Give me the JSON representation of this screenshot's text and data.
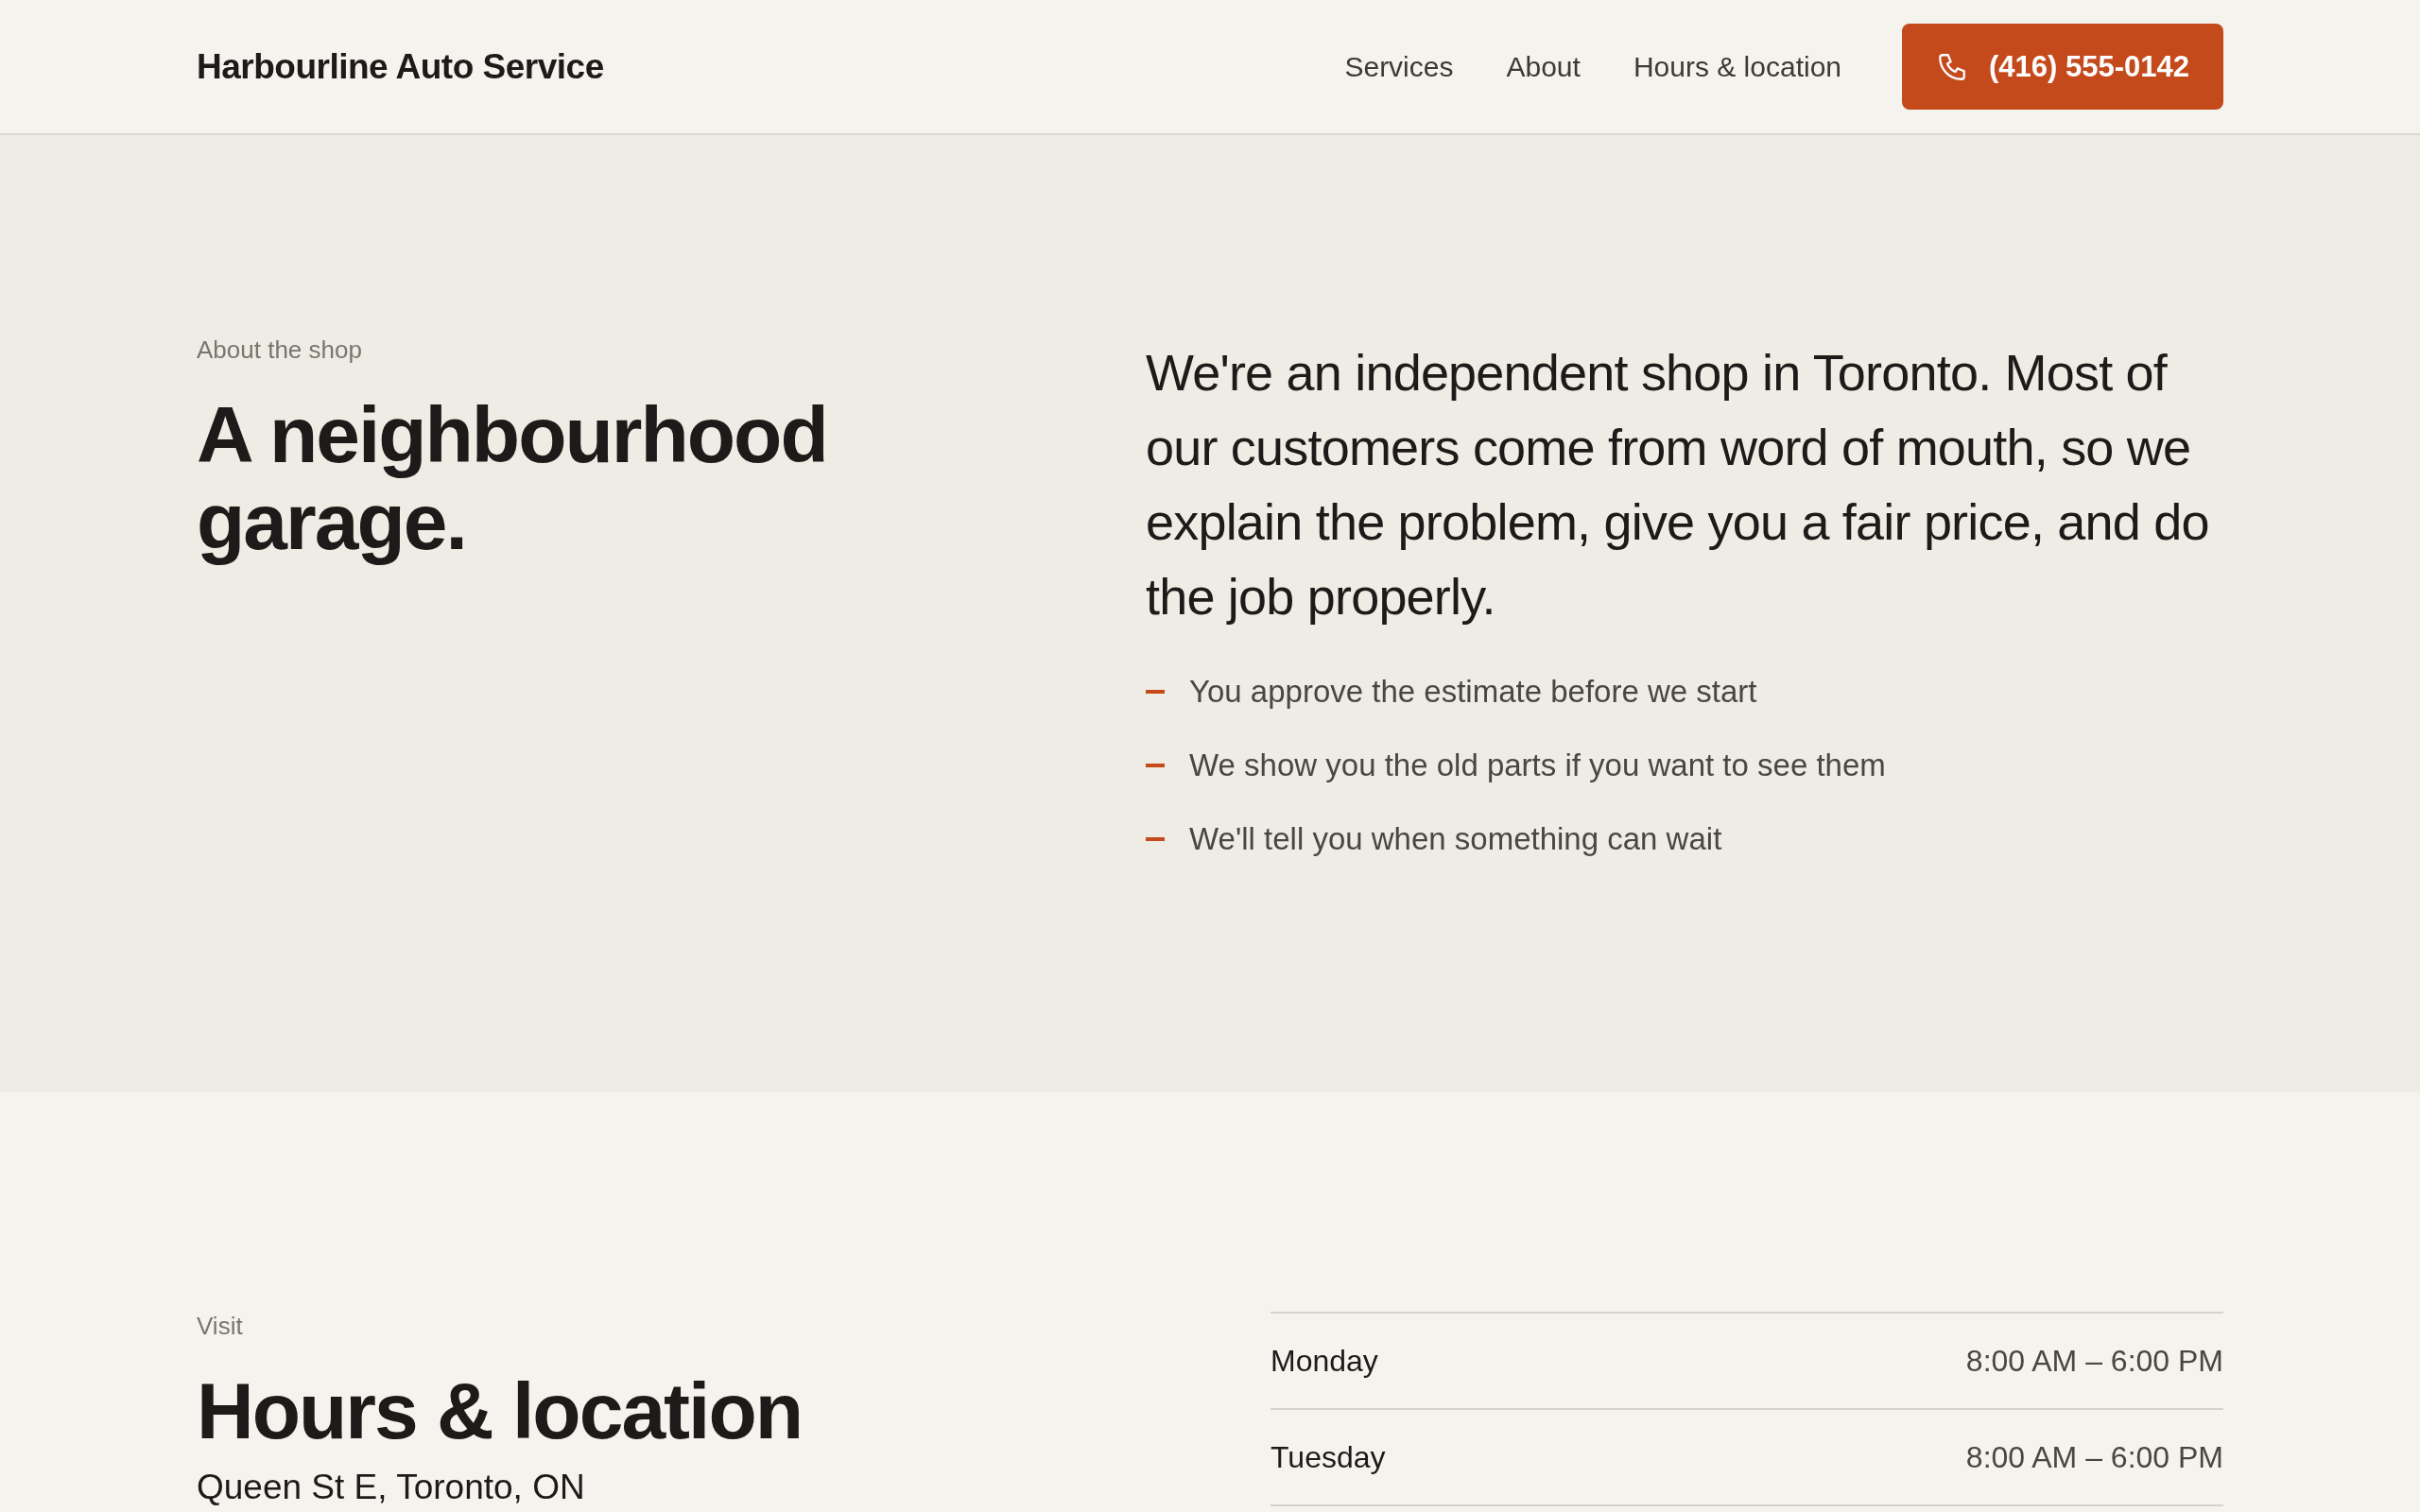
{
  "header": {
    "brand": "Harbourline Auto Service",
    "nav": [
      "Services",
      "About",
      "Hours & location"
    ],
    "phone_button": "(416) 555-0142"
  },
  "about": {
    "eyebrow": "About the shop",
    "heading": "A neighbourhood garage.",
    "intro": "We're an independent shop in Toronto. Most of our customers come from word of mouth, so we explain the problem, give you a fair price, and do the job properly.",
    "points": [
      "You approve the estimate before we start",
      "We show you the old parts if you want to see them",
      "We'll tell you when something can wait"
    ]
  },
  "visit": {
    "eyebrow": "Visit",
    "heading": "Hours & location",
    "address": "Queen St E, Toronto, ON",
    "hours": [
      {
        "day": "Monday",
        "time": "8:00 AM – 6:00 PM"
      },
      {
        "day": "Tuesday",
        "time": "8:00 AM – 6:00 PM"
      }
    ]
  }
}
